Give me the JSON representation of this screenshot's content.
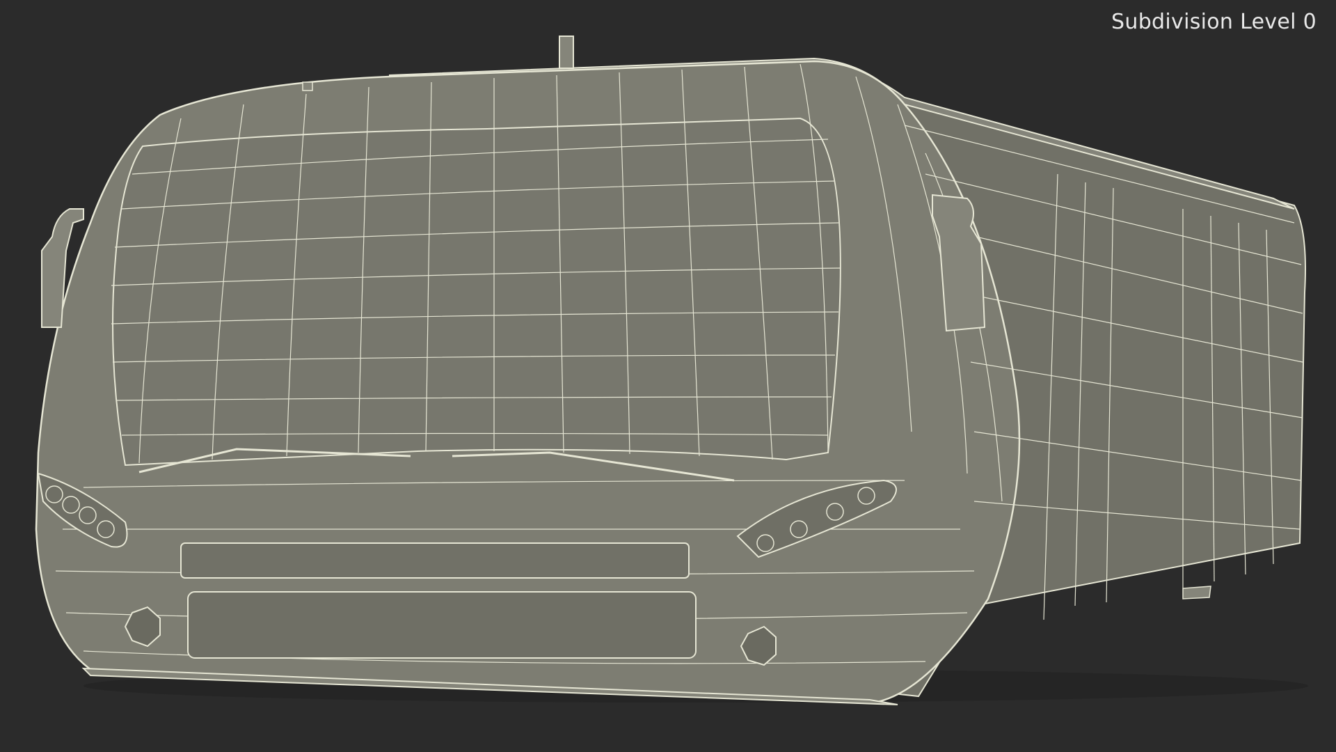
{
  "viewport": {
    "overlay_text": "Subdivision Level 0",
    "colors": {
      "background": "#2b2b2b",
      "surface": "#7c7c71",
      "surface_dark": "#6c6c62",
      "wire": "#e6e6d4"
    }
  }
}
